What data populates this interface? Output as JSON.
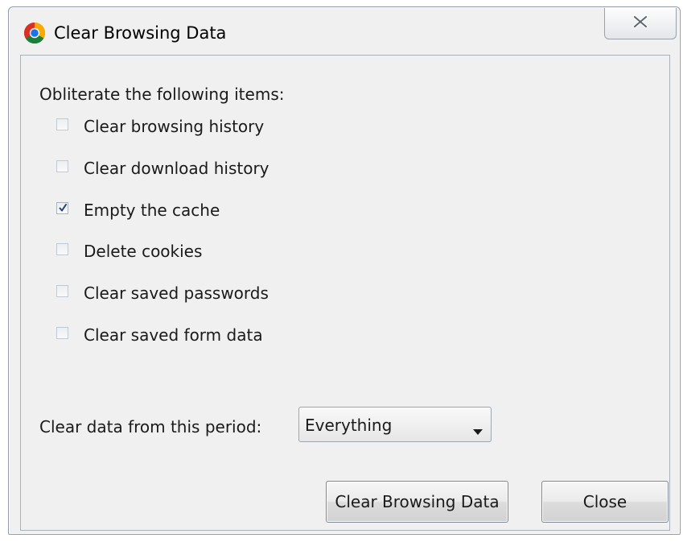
{
  "window": {
    "title": "Clear Browsing Data",
    "app_icon": "chrome-logo-icon",
    "close_icon": "close-icon"
  },
  "dialog": {
    "heading": "Obliterate the following items:",
    "options": [
      {
        "label": "Clear browsing history",
        "checked": false
      },
      {
        "label": "Clear download history",
        "checked": false
      },
      {
        "label": "Empty the cache",
        "checked": true
      },
      {
        "label": "Delete cookies",
        "checked": false
      },
      {
        "label": "Clear saved passwords",
        "checked": false
      },
      {
        "label": "Clear saved form data",
        "checked": false
      }
    ],
    "period_label": "Clear data from this period:",
    "period_value": "Everything"
  },
  "buttons": {
    "clear_label": "Clear Browsing Data",
    "close_label": "Close"
  },
  "colors": {
    "dialog_bg": "#f0f0f0",
    "border": "#8f9aa6",
    "checkmark": "#26457a"
  }
}
